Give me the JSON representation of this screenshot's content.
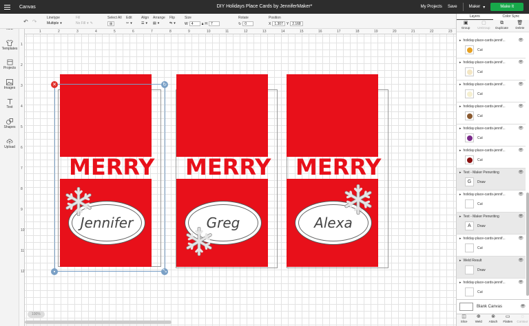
{
  "app": {
    "name": "Canvas",
    "document_title": "DIY Holidays Place Cards by JenniferMaker*"
  },
  "topbar": {
    "my_projects": "My Projects",
    "save": "Save",
    "machine": "Maker",
    "make_it": "Make It"
  },
  "toolbar": {
    "linetype_label": "Linetype",
    "linetype_value": "Multiple",
    "fill_label": "Fill",
    "fill_value": "No Fill",
    "select_all_label": "Select All",
    "edit_label": "Edit",
    "align_label": "Align",
    "arrange_label": "Arrange",
    "flip_label": "Flip",
    "size_label": "Size",
    "width_label": "W",
    "width_value": "4",
    "height_label": "H",
    "height_value": "7",
    "rotate_label": "Rotate",
    "rotate_value": "0",
    "position_label": "Position",
    "x_label": "X",
    "x_value": "1.307",
    "y_label": "Y",
    "y_value": "2.168"
  },
  "leftpanel": {
    "items": [
      {
        "label": "New",
        "icon": "plus-icon"
      },
      {
        "label": "Templates",
        "icon": "shirt-icon"
      },
      {
        "label": "Projects",
        "icon": "projects-icon"
      },
      {
        "label": "Images",
        "icon": "image-icon"
      },
      {
        "label": "Text",
        "icon": "text-icon"
      },
      {
        "label": "Shapes",
        "icon": "shapes-icon"
      },
      {
        "label": "Upload",
        "icon": "upload-icon"
      }
    ]
  },
  "rulers": {
    "top": [
      "1",
      "2",
      "3",
      "4",
      "5",
      "6",
      "7",
      "8",
      "9",
      "10",
      "11",
      "12",
      "13",
      "14",
      "15",
      "16",
      "17",
      "18",
      "19",
      "20",
      "21",
      "22",
      "23"
    ],
    "left": [
      "1",
      "2",
      "3",
      "4",
      "5",
      "6",
      "7",
      "8",
      "9",
      "10",
      "11",
      "12"
    ]
  },
  "canvas": {
    "cards": [
      {
        "greeting": "MERRY",
        "name": "Jennifer"
      },
      {
        "greeting": "MERRY",
        "name": "Greg"
      },
      {
        "greeting": "MERRY",
        "name": "Alexa"
      }
    ],
    "zoom_label": "100%",
    "card_color": "#e8101a"
  },
  "layers_panel": {
    "tabs": [
      "Layers",
      "Color Sync"
    ],
    "actions": [
      "Group",
      "UnGroup",
      "Duplicate",
      "Delete"
    ],
    "layers": [
      {
        "name": "holiday-place-cards-jennif...",
        "op": "Cut",
        "thumb_color": "#e6a020"
      },
      {
        "name": "holiday-place-cards-jennif...",
        "op": "Cut",
        "thumb_color": "#f3e6c4"
      },
      {
        "name": "holiday-place-cards-jennif...",
        "op": "Cut",
        "thumb_color": "#f5efd0"
      },
      {
        "name": "holiday-place-cards-jennif...",
        "op": "Cut",
        "thumb_color": "#8a5a30"
      },
      {
        "name": "holiday-place-cards-jennif...",
        "op": "Cut",
        "thumb_color": "#7a2a8a"
      },
      {
        "name": "holiday-place-cards-jennif...",
        "op": "Cut",
        "thumb_color": "#8a1010"
      },
      {
        "name": "Text - Maker Penwriting",
        "op": "Draw",
        "thumb_glyph": "G"
      },
      {
        "name": "holiday-place-cards-jennif...",
        "op": "Cut",
        "thumb_color": "#ffffff"
      },
      {
        "name": "Text - Maker Penwriting",
        "op": "Draw",
        "thumb_glyph": "A"
      },
      {
        "name": "holiday-place-cards-jennif...",
        "op": "Cut",
        "thumb_color": "#ffffff"
      },
      {
        "name": "Weld Result",
        "op": "Draw",
        "thumb_color": "#ffffff"
      },
      {
        "name": "holiday-place-cards-jennif...",
        "op": "Cut",
        "thumb_color": "#ffffff"
      }
    ],
    "blank_canvas": "Blank Canvas",
    "bottom_actions": [
      "Slice",
      "Weld",
      "Attach",
      "Flatten",
      "Contour"
    ]
  }
}
